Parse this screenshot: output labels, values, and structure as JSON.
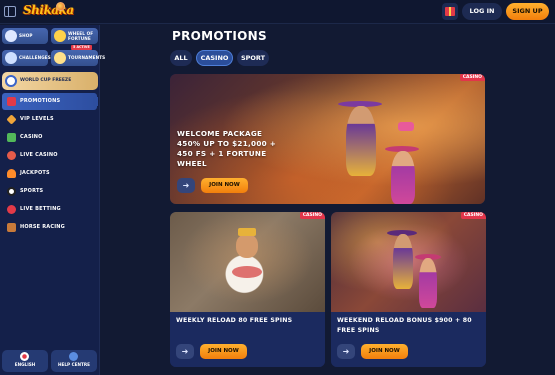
{
  "header": {
    "logo_text": "Shikaka",
    "login_label": "LOG IN",
    "signup_label": "SIGN UP"
  },
  "sidebar": {
    "tiles": [
      {
        "label": "SHOP"
      },
      {
        "label_line1": "WHEEL OF",
        "label_line2": "FORTUNE"
      },
      {
        "label": "CHALLENGES"
      },
      {
        "label": "TOURNAMENTS",
        "tag": "5 ACTIVE"
      }
    ],
    "world_cup": {
      "label": "WORLD CUP FREEZE"
    },
    "nav": [
      {
        "label": "PROMOTIONS",
        "icon": "gift-icon",
        "color": "#e33a48",
        "active": true
      },
      {
        "label": "VIP LEVELS",
        "icon": "diamond-icon",
        "color": "#f0a53a"
      },
      {
        "label": "CASINO",
        "icon": "cards-icon",
        "color": "#52b85a"
      },
      {
        "label": "LIVE CASINO",
        "icon": "roulette-icon",
        "color": "#e55b4a"
      },
      {
        "label": "JACKPOTS",
        "icon": "jackpot-icon",
        "color": "#ff8c2a"
      },
      {
        "label": "SPORTS",
        "icon": "ball-icon",
        "color": "#ffffff"
      },
      {
        "label": "LIVE BETTING",
        "icon": "live-icon",
        "color": "#e33a48"
      },
      {
        "label": "HORSE RACING",
        "icon": "horse-icon",
        "color": "#c87a3a"
      }
    ],
    "bottom": {
      "language_label": "ENGLISH",
      "help_label": "HELP CENTRE"
    }
  },
  "main": {
    "title": "PROMOTIONS",
    "filters": [
      "ALL",
      "CASINO",
      "SPORT"
    ],
    "active_filter": "CASINO",
    "hero": {
      "badge": "CASINO",
      "title_line1": "WELCOME PACKAGE",
      "title_line2": "450% UP TO $21,000 +",
      "title_line3": "450 FS + 1 FORTUNE",
      "title_line4": "WHEEL",
      "button": "JOIN NOW"
    },
    "cards": [
      {
        "badge": "CASINO",
        "title": "WEEKLY RELOAD 80 FREE SPINS",
        "button": "JOIN NOW"
      },
      {
        "badge": "CASINO",
        "title_line1": "WEEKEND RELOAD BONUS $900 + 80",
        "title_line2": "FREE SPINS",
        "button": "JOIN NOW"
      }
    ]
  },
  "colors": {
    "accent_orange": "#f59a1e",
    "badge_red": "#e2354a",
    "active_blue": "#2d4ea0",
    "background": "#121a33"
  }
}
